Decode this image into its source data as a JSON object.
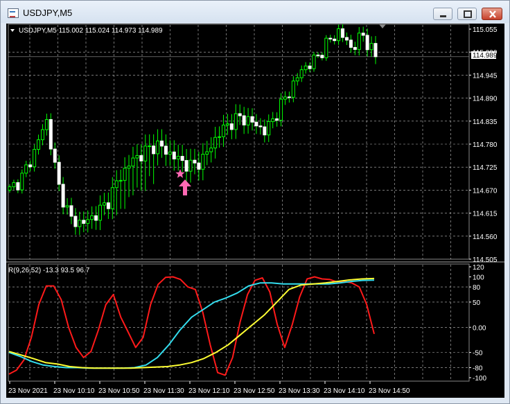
{
  "window": {
    "title": "USDJPY,M5",
    "buttons": [
      "minimize",
      "maximize",
      "close"
    ]
  },
  "main_chart": {
    "header": "USDJPY,M5  115.002 115.024 114.973 114.989",
    "price_tag": "114.989",
    "y_ticks": [
      "115.055",
      "115.000",
      "114.945",
      "114.890",
      "114.835",
      "114.780",
      "114.725",
      "114.670",
      "114.615",
      "114.560",
      "114.505"
    ]
  },
  "indicator": {
    "header": "R(9,26,52) -13.3 93.5 96.7",
    "y_ticks": [
      "120",
      "100",
      "80",
      "50",
      "0.00",
      "-50",
      "-80",
      "-100"
    ]
  },
  "x_ticks": [
    "23 Nov 2021",
    "23 Nov 10:10",
    "23 Nov 10:50",
    "23 Nov 11:30",
    "23 Nov 12:10",
    "23 Nov 12:50",
    "23 Nov 13:30",
    "23 Nov 14:10",
    "23 Nov 14:50"
  ],
  "signal": {
    "marker": "star",
    "arrow": "up"
  },
  "colors": {
    "background": "#000000",
    "grid": "#c0c0c0",
    "candle": "#00ff00",
    "red_line": "#ff1a1a",
    "cyan_line": "#33ddee",
    "yellow_line": "#ffff33",
    "signal": "#ff69b4"
  },
  "chart_data": [
    {
      "type": "candlestick",
      "y_range": [
        114.505,
        115.055
      ],
      "approx_close_path": [
        114.67,
        114.7,
        114.76,
        114.84,
        114.68,
        114.6,
        114.59,
        114.61,
        114.64,
        114.7,
        114.74,
        114.76,
        114.78,
        114.76,
        114.74,
        114.725,
        114.75,
        114.8,
        114.83,
        114.845,
        114.83,
        114.81,
        114.86,
        114.91,
        114.96,
        114.98,
        115.02,
        115.05,
        115.01,
        115.04,
        114.989
      ],
      "last": {
        "open": 115.002,
        "high": 115.024,
        "low": 114.973,
        "close": 114.989
      }
    },
    {
      "type": "line",
      "y_range": [
        -100,
        120
      ],
      "series": [
        {
          "values": [
            -93,
            -85,
            -65,
            -20,
            45,
            82,
            82,
            55,
            0,
            -40,
            -60,
            -48,
            -5,
            45,
            65,
            20,
            -10,
            -40,
            -20,
            45,
            85,
            99,
            100,
            95,
            80,
            75,
            30,
            -35,
            -90,
            -95,
            -60,
            10,
            65,
            93,
            98,
            70,
            5,
            -40,
            5,
            60,
            96,
            100,
            96,
            95,
            90,
            91,
            88,
            80,
            45,
            -13.3
          ]
        },
        {
          "values": [
            -50,
            -58,
            -68,
            -75,
            -78,
            -80,
            -80,
            -81,
            -81,
            -81,
            -81,
            -80,
            -75,
            -60,
            -35,
            -5,
            20,
            35,
            50,
            58,
            68,
            82,
            88,
            88,
            86,
            86,
            86,
            86,
            86,
            88,
            91,
            93,
            93.5
          ]
        },
        {
          "values": [
            -48,
            -55,
            -62,
            -70,
            -73,
            -78,
            -80,
            -81,
            -81,
            -81,
            -81,
            -80,
            -79,
            -78,
            -75,
            -70,
            -62,
            -50,
            -35,
            -15,
            5,
            25,
            50,
            75,
            84,
            86,
            88,
            91,
            94,
            96,
            96.7
          ]
        }
      ]
    }
  ]
}
